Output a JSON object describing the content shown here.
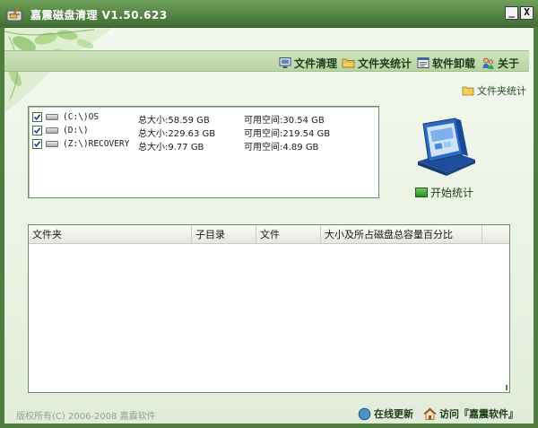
{
  "window": {
    "title": "嘉震磁盘清理  V1.50.623",
    "minimize_label": "_",
    "close_label": "X"
  },
  "toolbar": {
    "items": [
      {
        "label": "文件清理",
        "icon": "monitor-icon"
      },
      {
        "label": "文件夹统计",
        "icon": "folder-icon"
      },
      {
        "label": "软件卸载",
        "icon": "list-window-icon"
      },
      {
        "label": "关于",
        "icon": "help-people-icon"
      }
    ]
  },
  "section": {
    "label": "文件夹统计"
  },
  "drives": [
    {
      "checked": true,
      "name": "(C:\\)OS",
      "total": "总大小:58.59 GB",
      "free": "可用空间:30.54 GB"
    },
    {
      "checked": true,
      "name": "(D:\\)",
      "total": "总大小:229.63 GB",
      "free": "可用空间:219.54 GB"
    },
    {
      "checked": true,
      "name": "(Z:\\)RECOVERY",
      "total": "总大小:9.77 GB",
      "free": "可用空间:4.89 GB"
    }
  ],
  "start": {
    "label": "开始统计"
  },
  "results": {
    "columns": [
      "文件夹",
      "子目录",
      "文件",
      "大小及所占磁盘总容量百分比"
    ],
    "rows": []
  },
  "footer": {
    "copyright": "版权所有(C) 2006-2008 嘉震软件",
    "update_label": "在线更新",
    "visit_label": "访问『嘉震软件』"
  },
  "colors": {
    "titlebar": "#4e7d3e",
    "toolbar": "#c4dab2",
    "accent_green": "#3d9a3a"
  }
}
